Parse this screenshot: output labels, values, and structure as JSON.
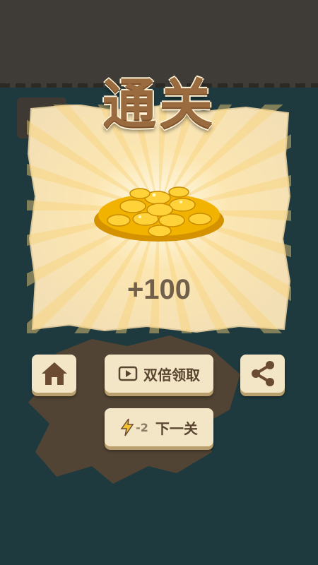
{
  "title": "通关",
  "reward": {
    "text": "+100",
    "icon": "gold-coins-pile"
  },
  "buttons": {
    "home": {
      "icon": "home-icon"
    },
    "double": {
      "icon": "video-play-icon",
      "label": "双倍领取"
    },
    "share": {
      "icon": "share-icon"
    },
    "next": {
      "icon": "lightning-icon",
      "cost": "-2",
      "label": "下一关"
    }
  },
  "colors": {
    "background": "#1f3a3e",
    "paper": "#f6e9c8",
    "title": "#9a6b3e",
    "button": "#f3e6c6",
    "text": "#5a4630",
    "coin": "#f5b400"
  }
}
